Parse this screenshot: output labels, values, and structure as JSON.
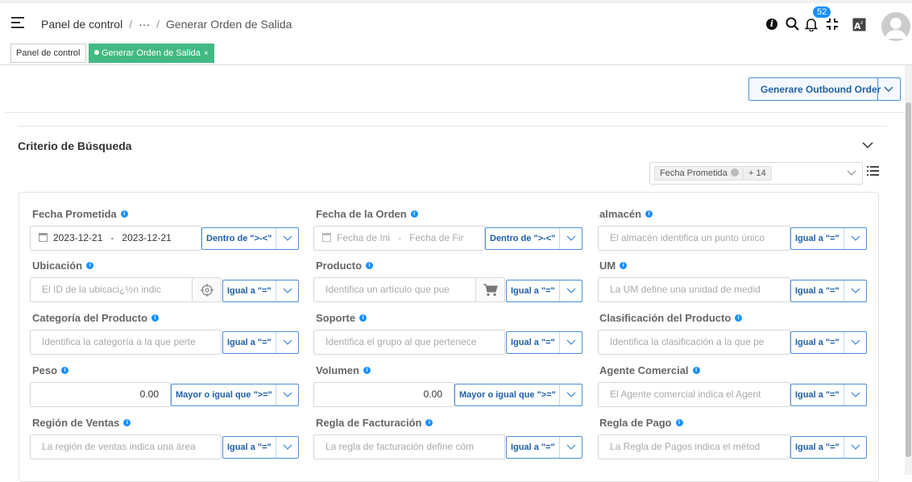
{
  "header": {
    "breadcrumb": [
      "Panel de control",
      "···",
      "Generar Orden de Salida"
    ],
    "notifications_count": "52",
    "icons": [
      "menu-icon",
      "info-icon",
      "search-icon",
      "bell-icon",
      "fullscreen-icon",
      "translate-icon",
      "avatar-icon"
    ]
  },
  "tabs": [
    {
      "label": "Panel de control",
      "active": false
    },
    {
      "label": "Generar Orden de Salida",
      "active": true,
      "close": "×"
    }
  ],
  "toolbar": {
    "generate_label": "Generare Outbound Order"
  },
  "criteria": {
    "title": "Criterio de Búsqueda",
    "tags": [
      "Fecha Prometida",
      "+ 14"
    ]
  },
  "fields": {
    "fecha_prometida": {
      "label": "Fecha Prometida",
      "from": "2023-12-21",
      "dash": "-",
      "to": "2023-12-21",
      "op": "Dentro de \">-<\""
    },
    "fecha_orden": {
      "label": "Fecha de la Orden",
      "from": "Fecha de Ini",
      "dash": "-",
      "to": "Fecha de Fir",
      "op": "Dentro de \">-<\""
    },
    "almacen": {
      "label": "almacén",
      "placeholder": "El almacén identifica un punto único",
      "op": "Igual a \"=\""
    },
    "ubicacion": {
      "label": "Ubicación",
      "placeholder": "El ID de la ubicaci¿½n indic",
      "op": "Igual a \"=\""
    },
    "producto": {
      "label": "Producto",
      "placeholder": "Identifica un artículo que pue",
      "op": "Igual a \"=\""
    },
    "um": {
      "label": "UM",
      "placeholder": "La UM define una unidad de medid",
      "op": "Igual a \"=\""
    },
    "categoria": {
      "label": "Categoría del Producto",
      "placeholder": "Identifica la categoría a la que perte",
      "op": "Igual a \"=\""
    },
    "soporte": {
      "label": "Soporte",
      "placeholder": "Identifica el grupo al que pertenece",
      "op": "Igual a \"=\""
    },
    "clasificacion": {
      "label": "Clasificación del Producto",
      "placeholder": "Identifica la clasificación a la que pe",
      "op": "Igual a \"=\""
    },
    "peso": {
      "label": "Peso",
      "value": "0.00",
      "op": "Mayor o igual que \">=\""
    },
    "volumen": {
      "label": "Volumen",
      "value": "0.00",
      "op": "Mayor o igual que \">=\""
    },
    "agente": {
      "label": "Agente Comercial",
      "placeholder": "El Agente comercial indica el Agent",
      "op": "Igual a \"=\""
    },
    "region": {
      "label": "Región de Ventas",
      "placeholder": "La región de ventas indica una área",
      "op": "Igual a \"=\""
    },
    "facturacion": {
      "label": "Regla de Facturación",
      "placeholder": "La regla de facturación define cóm",
      "op": "Igual a \"=\""
    },
    "pago": {
      "label": "Regla de Pago",
      "placeholder": "La Regla de Pagos indica el métod",
      "op": "Igual a \"=\""
    }
  }
}
